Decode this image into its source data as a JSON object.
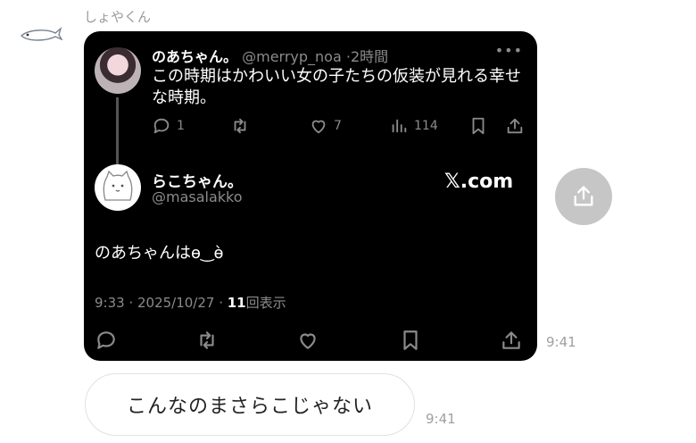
{
  "sender": {
    "name": "しょやくん"
  },
  "card": {
    "quoted": {
      "name": "のあちゃん。",
      "handle": "@merryp_noa",
      "sep": "·",
      "time": "2時間",
      "text": "この時期はかわいい女の子たちの仮装が見れる幸せな時期。",
      "replies": "1",
      "likes": "7",
      "views": "114"
    },
    "post": {
      "name": "らこちゃん。",
      "handle": "@masalakko",
      "text": "のあちゃんはɵ‿ɵ̀",
      "time": "9:33 · 2025/10/27 · ",
      "views_count": "11",
      "views_label": "回表示"
    },
    "link_label": "𝕏.com"
  },
  "time1": "9:41",
  "reply": {
    "text": "こんなのまさらこじゃない",
    "time": "9:41"
  }
}
